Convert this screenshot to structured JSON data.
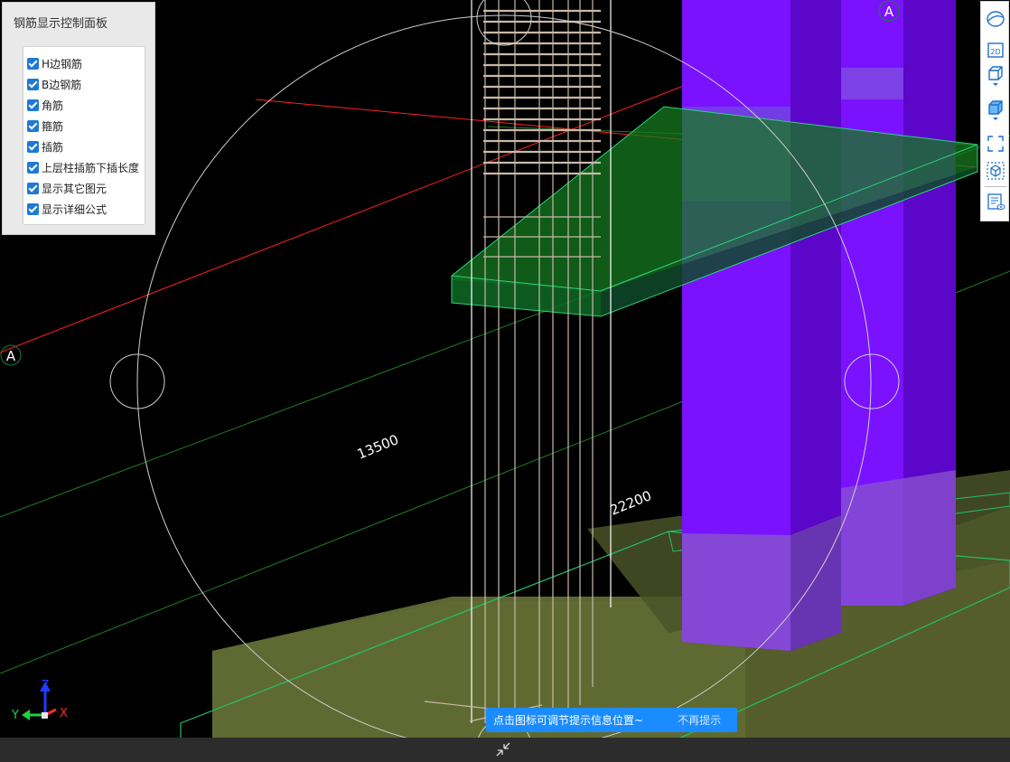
{
  "panel": {
    "title": "钢筋显示控制面板",
    "options": [
      {
        "label": "H边钢筋",
        "checked": true
      },
      {
        "label": "B边钢筋",
        "checked": true
      },
      {
        "label": "角筋",
        "checked": true
      },
      {
        "label": "箍筋",
        "checked": true
      },
      {
        "label": "插筋",
        "checked": true
      },
      {
        "label": "上层柱插筋下插长度",
        "checked": true
      },
      {
        "label": "显示其它图元",
        "checked": true
      },
      {
        "label": "显示详细公式",
        "checked": true
      }
    ]
  },
  "scene": {
    "dimension_left": "13500",
    "dimension_right": "22200",
    "axis_label_left": "A",
    "axis_label_top": "A",
    "axis_x": "X",
    "axis_y": "Y",
    "axis_z": "Z",
    "colors": {
      "column": "#7a12ff",
      "slab": "#1fae3a",
      "footing": "#7e8a43",
      "rebar": "#c9b9a8",
      "grid_red": "#ff2020",
      "grid_green": "#1e7e2a"
    }
  },
  "toolbar": {
    "items": [
      "orbit-icon",
      "2d-view-icon",
      "3d-wireframe-icon",
      "3d-solid-icon",
      "fullscreen-icon",
      "element-select-icon",
      "property-view-icon"
    ],
    "view_2d": "2D"
  },
  "tip": {
    "message": "点击图标可调节提示信息位置~",
    "dismiss": "不再提示"
  }
}
